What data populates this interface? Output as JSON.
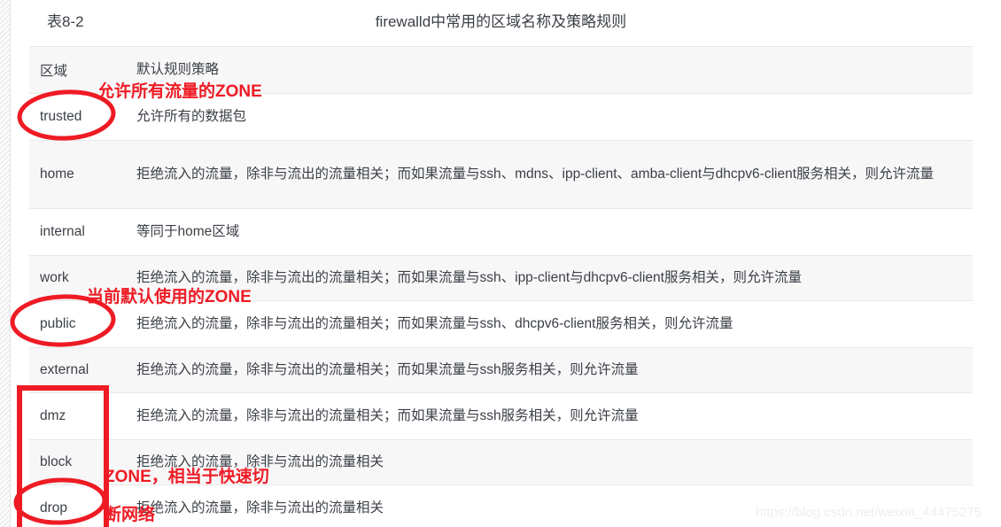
{
  "caption": {
    "number": "表8-2",
    "title": "firewalld中常用的区域名称及策略规则"
  },
  "table": {
    "headers": [
      "区域",
      "默认规则策略"
    ],
    "rows": [
      {
        "zone": "trusted",
        "policy": "允许所有的数据包"
      },
      {
        "zone": "home",
        "policy": "拒绝流入的流量，除非与流出的流量相关；而如果流量与ssh、mdns、ipp-client、amba-client与dhcpv6-client服务相关，则允许流量"
      },
      {
        "zone": "internal",
        "policy": "等同于home区域"
      },
      {
        "zone": "work",
        "policy": "拒绝流入的流量，除非与流出的流量相关；而如果流量与ssh、ipp-client与dhcpv6-client服务相关，则允许流量"
      },
      {
        "zone": "public",
        "policy": "拒绝流入的流量，除非与流出的流量相关；而如果流量与ssh、dhcpv6-client服务相关，则允许流量"
      },
      {
        "zone": "external",
        "policy": "拒绝流入的流量，除非与流出的流量相关；而如果流量与ssh服务相关，则允许流量"
      },
      {
        "zone": "dmz",
        "policy": "拒绝流入的流量，除非与流出的流量相关；而如果流量与ssh服务相关，则允许流量"
      },
      {
        "zone": "block",
        "policy": "拒绝流入的流量，除非与流出的流量相关"
      },
      {
        "zone": "drop",
        "policy": "拒绝流入的流量，除非与流出的流量相关"
      }
    ]
  },
  "annotations": {
    "color": "#ee1b24",
    "note_trusted": "允许所有流量的ZONE",
    "note_public": "当前默认使用的ZONE",
    "note_block_line1": "ZONE，相当于快速切",
    "note_block_line2": "断网络"
  },
  "watermark": "https://blog.csdn.net/weixin_44475275"
}
